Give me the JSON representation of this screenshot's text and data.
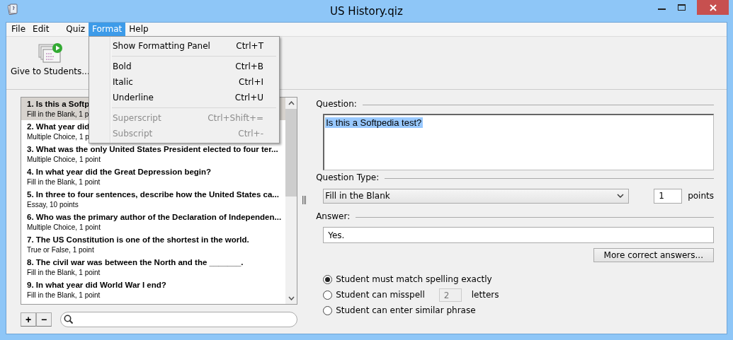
{
  "window": {
    "title": "US History.qiz"
  },
  "menu_bar": [
    {
      "label": "File",
      "selected": false
    },
    {
      "label": "Edit",
      "selected": false
    },
    {
      "label": "Quiz",
      "selected": false
    },
    {
      "label": "Format",
      "selected": true
    },
    {
      "label": "Help",
      "selected": false
    }
  ],
  "format_menu": [
    {
      "kind": "item",
      "label": "Show Formatting Panel",
      "shortcut": "Ctrl+T",
      "disabled": false
    },
    {
      "kind": "separator"
    },
    {
      "kind": "item",
      "label": "Bold",
      "shortcut": "Ctrl+B",
      "disabled": false
    },
    {
      "kind": "item",
      "label": "Italic",
      "shortcut": "Ctrl+I",
      "disabled": false
    },
    {
      "kind": "item",
      "label": "Underline",
      "shortcut": "Ctrl+U",
      "disabled": false
    },
    {
      "kind": "separator"
    },
    {
      "kind": "item",
      "label": "Superscript",
      "shortcut": "Ctrl+Shift+=",
      "disabled": true
    },
    {
      "kind": "item",
      "label": "Subscript",
      "shortcut": "Ctrl+-",
      "disabled": true
    }
  ],
  "toolbar": [
    {
      "label": "Give to Students..."
    }
  ],
  "questions": [
    {
      "title": "1. Is this a Softp",
      "detail": "Fill in the Blank, 1 p",
      "selected": true
    },
    {
      "title": "2. What year did",
      "detail": "Multiple Choice, 1 p",
      "selected": false
    },
    {
      "title": "3. What was the only United States President elected to four ter...",
      "detail": "Multiple Choice, 1 point",
      "selected": false
    },
    {
      "title": "4. In what year did the Great Depression begin?",
      "detail": "Fill in the Blank, 1 point",
      "selected": false
    },
    {
      "title": "5. In three to four sentences, describe how the United States ca...",
      "detail": "Essay, 10 points",
      "selected": false
    },
    {
      "title": "6. Who was the primary author of the Declaration of Independen...",
      "detail": "Multiple Choice, 1 point",
      "selected": false
    },
    {
      "title": "7. The US Constitution is one of the shortest in the world.",
      "detail": "True or False, 1 point",
      "selected": false
    },
    {
      "title": "8. The civil war was between the North and the _______.",
      "detail": "Fill in the Blank, 1 point",
      "selected": false
    },
    {
      "title": "9. In what year did World War I end?",
      "detail": "Fill in the Blank, 1 point",
      "selected": false
    }
  ],
  "list_buttons": [
    "+",
    "−"
  ],
  "editor": {
    "question_label": "Question:",
    "question_text": "Is this a Softpedia test?",
    "question_type_label": "Question Type:",
    "question_type": "Fill in the Blank",
    "points": "1",
    "points_label": "points",
    "answer_label": "Answer:",
    "answer": "Yes.",
    "more_button": "More correct answers...",
    "spelling_options": [
      {
        "kind": "plain",
        "label": "Student must match spelling exactly",
        "selected": true
      },
      {
        "kind": "count",
        "label": "Student can misspell",
        "value": "2",
        "suffix": "letters",
        "selected": false
      },
      {
        "kind": "plain",
        "label": "Student can enter similar phrase",
        "selected": false
      }
    ]
  }
}
